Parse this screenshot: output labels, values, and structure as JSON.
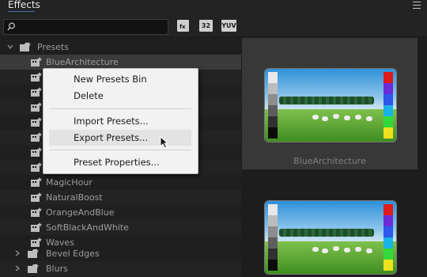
{
  "panel": {
    "title": "Effects"
  },
  "toolbar": {
    "search_value": "",
    "badges": [
      "32",
      "YUV"
    ]
  },
  "tree": {
    "presets_label": "Presets",
    "items": [
      "BlueArchitecture",
      "",
      "",
      "",
      "",
      "",
      "",
      "",
      "MagicHour",
      "NaturalBoost",
      "OrangeAndBlue",
      "SoftBlackAndWhite",
      "Waves"
    ],
    "folders_after": [
      "Bevel Edges",
      "Blurs"
    ]
  },
  "preview": {
    "selected_label": "BlueArchitecture"
  },
  "context_menu": {
    "items": [
      "New Presets Bin",
      "Delete",
      "Import Presets...",
      "Export Presets...",
      "Preset Properties..."
    ]
  },
  "colors": {
    "accent": "#5aa0ff",
    "panel_bg": "#1d1d1d",
    "menu_bg": "#f2f2f2"
  }
}
